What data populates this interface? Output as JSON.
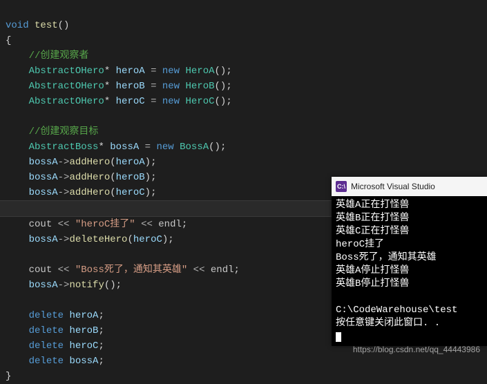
{
  "code": {
    "l0_void": "void",
    "l0_name": "test",
    "l0_paren": "()",
    "brace_open": "{",
    "comment1": "//创建观察者",
    "type_abs_hero": "AbstractOHero",
    "star": "*",
    "heroA": "heroA",
    "heroB": "heroB",
    "heroC": "heroC",
    "eq": "=",
    "kw_new": "new",
    "HeroA": "HeroA",
    "HeroB": "HeroB",
    "HeroC": "HeroC",
    "call_paren": "()",
    "semi": ";",
    "comment2": "//创建观察目标",
    "type_abs_boss": "AbstractBoss",
    "bossA": "bossA",
    "BossA": "BossA",
    "arrow": "->",
    "addHero": "addHero",
    "deleteHero": "deleteHero",
    "notify": "notify",
    "cout": "cout",
    "ins": "<<",
    "str1": "\"heroC挂了\"",
    "str2": "\"Boss死了，通知其英雄\"",
    "endl": "endl",
    "kw_delete": "delete",
    "brace_close": "}"
  },
  "console": {
    "title": "Microsoft Visual Studio ",
    "icon_label": "C:\\",
    "lines": [
      "英雄A正在打怪兽",
      "英雄B正在打怪兽",
      "英雄C正在打怪兽",
      "heroC挂了",
      "Boss死了，通知其英雄",
      "英雄A停止打怪兽",
      "英雄B停止打怪兽",
      "",
      "C:\\CodeWarehouse\\test",
      "按任意键关闭此窗口. ."
    ]
  },
  "watermark": "https://blog.csdn.net/qq_44443986"
}
